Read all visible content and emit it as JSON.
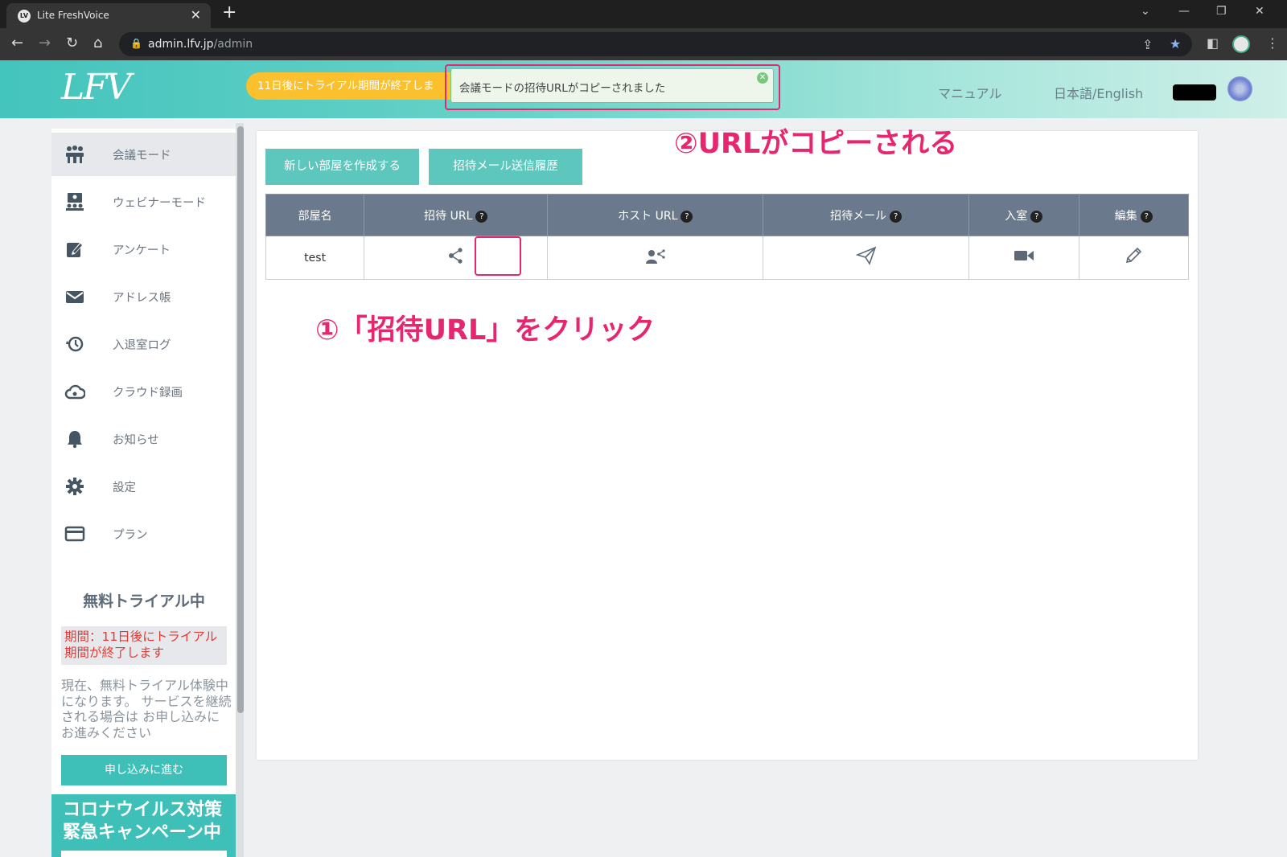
{
  "browser": {
    "tab_title": "Lite FreshVoice",
    "tab_close": "✕",
    "new_tab": "+",
    "url_host": "admin.lfv.jp",
    "url_path": "/admin"
  },
  "header": {
    "logo": "LFV",
    "trial_banner": "11日後にトライアル期間が終了しま",
    "toast": "会議モードの招待URLがコピーされました",
    "manual": "マニュアル",
    "language": "日本語/English"
  },
  "sidebar": {
    "items": [
      {
        "label": "会議モード",
        "icon": "meeting-icon"
      },
      {
        "label": "ウェビナーモード",
        "icon": "webinar-icon"
      },
      {
        "label": "アンケート",
        "icon": "survey-icon"
      },
      {
        "label": "アドレス帳",
        "icon": "mail-icon"
      },
      {
        "label": "入退室ログ",
        "icon": "history-icon"
      },
      {
        "label": "クラウド録画",
        "icon": "cloud-icon"
      },
      {
        "label": "お知らせ",
        "icon": "bell-icon"
      },
      {
        "label": "設定",
        "icon": "gear-icon"
      },
      {
        "label": "プラン",
        "icon": "card-icon"
      }
    ],
    "trial": {
      "title": "無料トライアル中",
      "period": "期間：11日後にトライアル期間が終了します",
      "description": "現在、無料トライアル体験中 になります。 サービスを継続される場合は お申し込みにお進みください",
      "apply_button": "申し込みに進む"
    },
    "campaign": "コロナウイルス対策緊急キャンペーン中"
  },
  "main": {
    "create_room_button": "新しい部屋を作成する",
    "invite_history_button": "招待メール送信履歴",
    "table": {
      "headers": [
        "部屋名",
        "招待 URL",
        "ホスト URL",
        "招待メール",
        "入室",
        "編集"
      ],
      "help_mark": "?",
      "rows": [
        {
          "room_name": "test"
        }
      ]
    }
  },
  "annotations": {
    "step1": "①「招待URL」をクリック",
    "step2": "②URLがコピーされる"
  }
}
